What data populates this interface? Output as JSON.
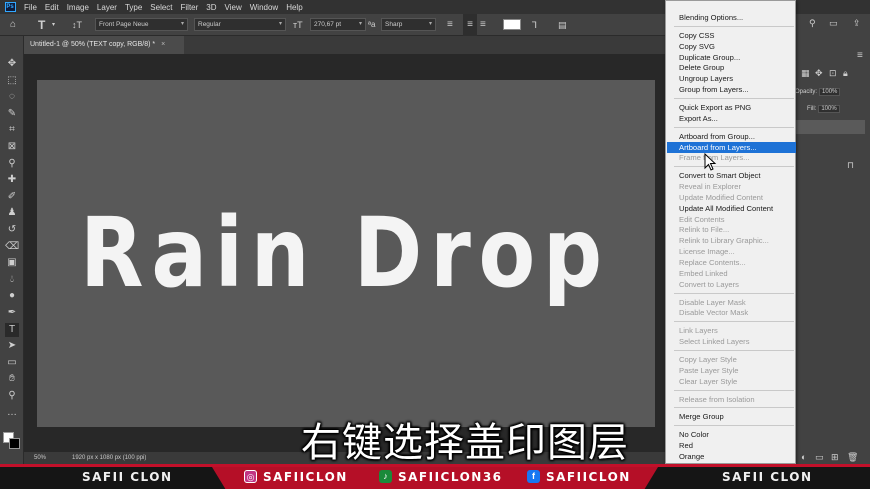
{
  "menubar": {
    "logo": "Ps",
    "items": [
      "File",
      "Edit",
      "Image",
      "Layer",
      "Type",
      "Select",
      "Filter",
      "3D",
      "View",
      "Window",
      "Help"
    ]
  },
  "options": {
    "font_family": "Front Page Neue",
    "font_style": "Regular",
    "font_size": "270,67 pt",
    "aa_label": "ªa",
    "antialias": "Sharp"
  },
  "document": {
    "tab_title": "Untitled-1 @ 50% (TEXT copy, RGB/8) *",
    "canvas_text": "Rain Drop",
    "zoom": "50%",
    "doc_info": "1920 px x 1080 px (100 ppi)"
  },
  "layers_panel": {
    "opacity_label": "Opacity:",
    "opacity_value": "100%",
    "fill_label": "Fill:",
    "fill_value": "100%"
  },
  "context_menu": {
    "items": [
      {
        "label": "Blending Options...",
        "state": "enabled"
      },
      {
        "label": "Copy CSS",
        "state": "enabled"
      },
      {
        "label": "Copy SVG",
        "state": "enabled"
      },
      {
        "label": "Duplicate Group...",
        "state": "enabled"
      },
      {
        "label": "Delete Group",
        "state": "enabled"
      },
      {
        "label": "Ungroup Layers",
        "state": "enabled"
      },
      {
        "label": "Group from Layers...",
        "state": "enabled"
      },
      {
        "label": "Quick Export as PNG",
        "state": "enabled"
      },
      {
        "label": "Export As...",
        "state": "enabled"
      },
      {
        "label": "Artboard from Group...",
        "state": "enabled"
      },
      {
        "label": "Artboard from Layers...",
        "state": "highlighted"
      },
      {
        "label": "Frame from Layers...",
        "state": "disabled"
      },
      {
        "label": "Convert to Smart Object",
        "state": "enabled"
      },
      {
        "label": "Reveal in Explorer",
        "state": "disabled"
      },
      {
        "label": "Update Modified Content",
        "state": "disabled"
      },
      {
        "label": "Update All Modified Content",
        "state": "enabled"
      },
      {
        "label": "Edit Contents",
        "state": "disabled"
      },
      {
        "label": "Relink to File...",
        "state": "disabled"
      },
      {
        "label": "Relink to Library Graphic...",
        "state": "disabled"
      },
      {
        "label": "License Image...",
        "state": "disabled"
      },
      {
        "label": "Replace Contents...",
        "state": "disabled"
      },
      {
        "label": "Embed Linked",
        "state": "disabled"
      },
      {
        "label": "Convert to Layers",
        "state": "disabled"
      },
      {
        "label": "Disable Layer Mask",
        "state": "disabled"
      },
      {
        "label": "Disable Vector Mask",
        "state": "disabled"
      },
      {
        "label": "Link Layers",
        "state": "disabled"
      },
      {
        "label": "Select Linked Layers",
        "state": "disabled"
      },
      {
        "label": "Copy Layer Style",
        "state": "disabled"
      },
      {
        "label": "Paste Layer Style",
        "state": "disabled"
      },
      {
        "label": "Clear Layer Style",
        "state": "disabled"
      },
      {
        "label": "Release from Isolation",
        "state": "disabled"
      },
      {
        "label": "Merge Group",
        "state": "enabled"
      },
      {
        "label": "No Color",
        "state": "enabled"
      },
      {
        "label": "Red",
        "state": "enabled"
      },
      {
        "label": "Orange",
        "state": "enabled"
      }
    ]
  },
  "subtitle": "右键选择盖印图层",
  "banner": {
    "left_name": "SAFII CLON",
    "instagram": "SAFIICLON",
    "tiktok": "SAFIICLON36",
    "facebook": "SAFIICLON",
    "right_name": "SAFII CLON"
  },
  "colors": {
    "highlight": "#1e72d6",
    "banner_red": "#b50f27"
  }
}
